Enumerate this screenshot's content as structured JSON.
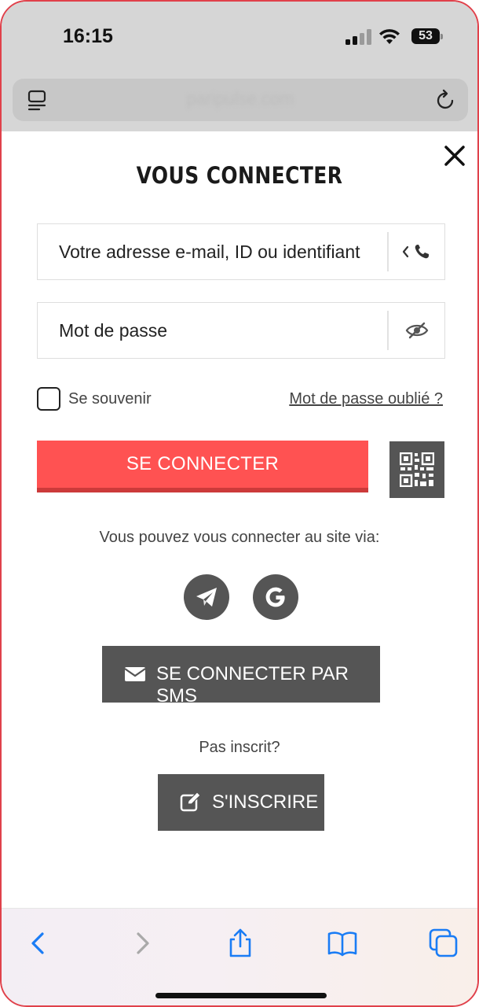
{
  "status_bar": {
    "time": "16:15",
    "battery": "53"
  },
  "browser": {
    "url": "paripulse.com"
  },
  "login": {
    "title": "VOUS CONNECTER",
    "email_placeholder": "Votre adresse e-mail, ID ou identifiant",
    "password_placeholder": "Mot de passe",
    "remember_label": "Se souvenir",
    "forgot_label": "Mot de passe oublié ?",
    "submit_label": "SE CONNECTER",
    "via_text": "Vous pouvez vous connecter au site via:",
    "social": [
      {
        "icon": "telegram-icon"
      },
      {
        "icon": "google-icon"
      }
    ],
    "sms_label": "SE CONNECTER PAR SMS",
    "not_registered": "Pas inscrit?",
    "register_label": "S'INSCRIRE"
  },
  "colors": {
    "accent": "#ff5252",
    "accent_shadow": "#cc3a3a",
    "dark_button": "#555555",
    "frame": "#e0414b",
    "safari_blue": "#1a7cf5"
  }
}
